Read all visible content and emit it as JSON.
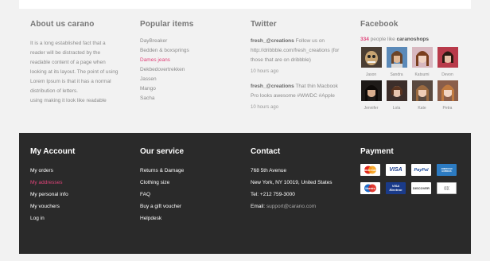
{
  "about": {
    "title": "About us carano",
    "lines": [
      "It is a long established fact that a",
      "reader will be distracted by the",
      "readable content of a page when",
      "looking at its layout. The point of using",
      "Lorem Ipsum is that it has a normal",
      "distribution of letters.",
      "using making it look like readable"
    ]
  },
  "popular": {
    "title": "Popular items",
    "items": [
      "DayBreaker",
      "Bedden & boxsprings",
      "Dames jeans",
      "Dekbedovertrekken",
      "Jassen",
      "Mango",
      "Sacha"
    ]
  },
  "twitter": {
    "title": "Twitter",
    "tweets": [
      {
        "handle": "fresh_@creations",
        "text": "Follow us on http://dribbble.com/fresh_creations (for those that are on dribbble)",
        "ago": "10 hours ago"
      },
      {
        "handle": "fresh_@creations",
        "text": "That thin Macbook Pro looks awesome #WWDC #Apple",
        "ago": "10 hours ago"
      }
    ]
  },
  "facebook": {
    "title": "Facebook",
    "count": "334",
    "people_like": "people like",
    "page": "caranoshops",
    "people": [
      "Jason",
      "Sandra",
      "Katsumi",
      "Devon",
      "Jennifer",
      "Lola",
      "Kate",
      "Petra"
    ]
  },
  "account": {
    "title": "My Account",
    "links": [
      "My orders",
      "My addresses",
      "My personal info",
      "My vouchers",
      "Log in"
    ]
  },
  "service": {
    "title": "Our service",
    "links": [
      "Returns & Damage",
      "Clothing size",
      "FAQ",
      "Buy a gift voucher",
      "Helpdesk"
    ]
  },
  "contact": {
    "title": "Contact",
    "street": "768 5th Avenue",
    "city": "New York, NY 10019, United States",
    "tel": "Tel: +212 759-3000",
    "email_label": "Email: ",
    "email": "support@carano.com"
  },
  "payment": {
    "title": "Payment",
    "cards": [
      "MasterCard",
      "VISA",
      "PayPal",
      "AMERICAN EXPRESS",
      "Maestro",
      "VISA Electron",
      "DISCOVER",
      "(((("
    ]
  },
  "colors": {
    "accent": "#e0447a",
    "footer_dark": "#2a2a2a",
    "upper_bg": "#f2f2f2"
  }
}
